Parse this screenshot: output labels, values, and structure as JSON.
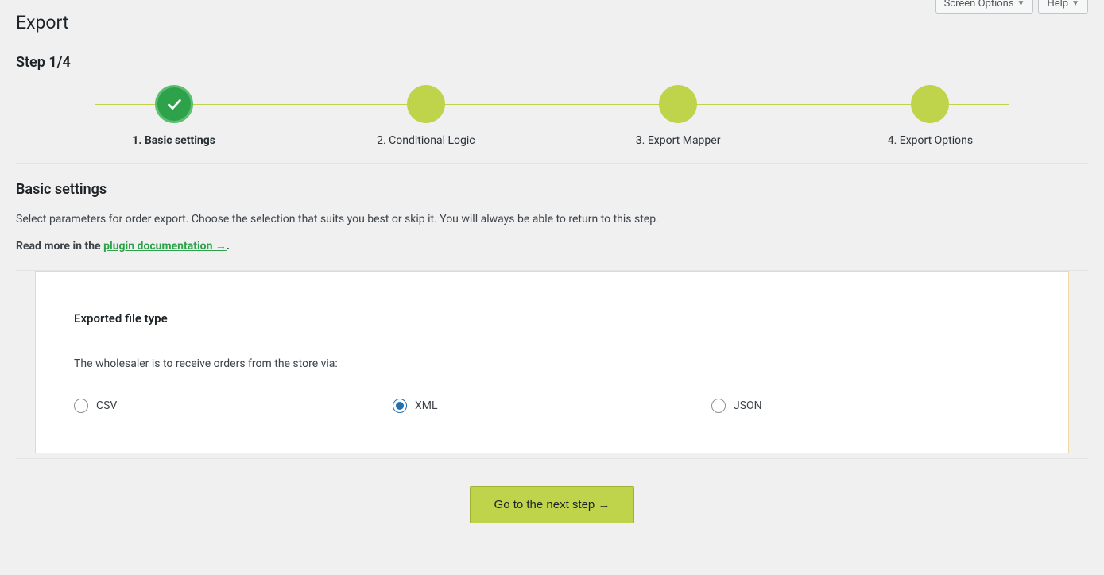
{
  "header": {
    "screen_options_label": "Screen Options",
    "help_label": "Help"
  },
  "page": {
    "title": "Export",
    "step_indicator": "Step 1/4"
  },
  "stepper": {
    "steps": [
      {
        "label": "1. Basic settings",
        "active": true
      },
      {
        "label": "2. Conditional Logic",
        "active": false
      },
      {
        "label": "3. Export Mapper",
        "active": false
      },
      {
        "label": "4. Export Options",
        "active": false
      }
    ]
  },
  "section": {
    "title": "Basic settings",
    "description": "Select parameters for order export. Choose the selection that suits you best or skip it. You will always be able to return to this step.",
    "doc_prefix": "Read more in the ",
    "doc_link_text": "plugin documentation →",
    "doc_suffix": "."
  },
  "card": {
    "title": "Exported file type",
    "description": "The wholesaler is to receive orders from the store via:",
    "options": [
      {
        "label": "CSV",
        "selected": false
      },
      {
        "label": "XML",
        "selected": true
      },
      {
        "label": "JSON",
        "selected": false
      }
    ]
  },
  "actions": {
    "next_button": "Go to the next step →"
  }
}
